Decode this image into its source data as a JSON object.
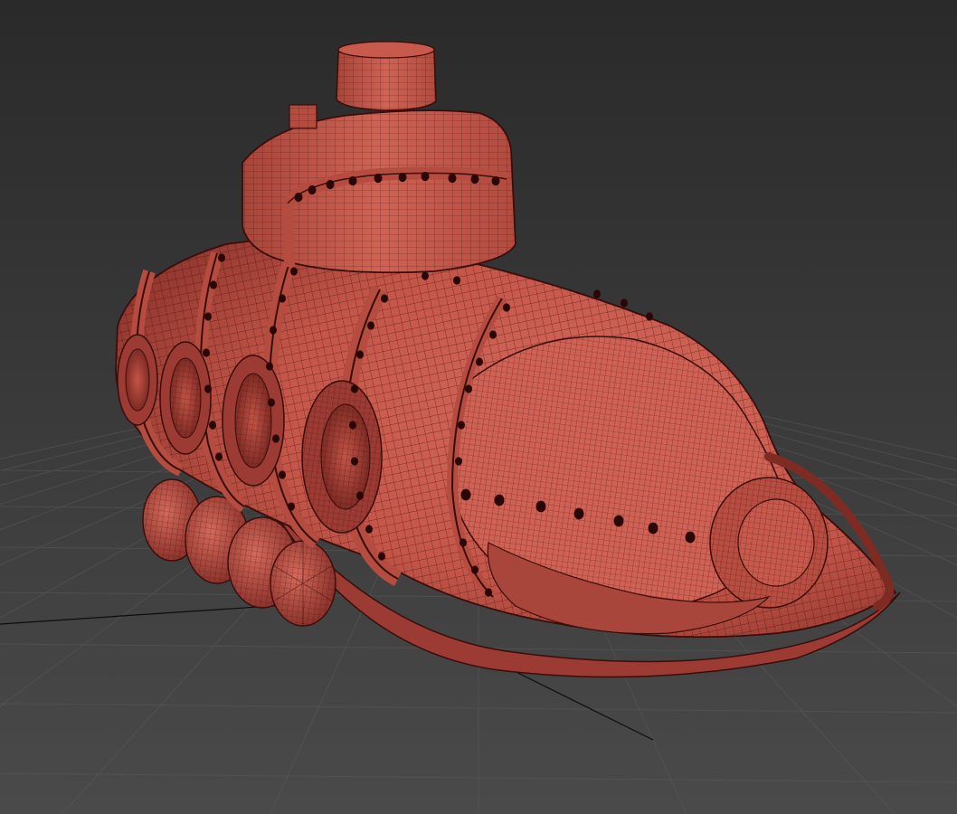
{
  "viewport": {
    "background_top": "#2e2e2e",
    "background_bottom": "#4a4a4a",
    "grid_color": "#5a5a5a",
    "axis_color": "#0d0d0d"
  },
  "model": {
    "name": "submarine",
    "base_color": "#c85a4e",
    "shade_color": "#8e342c",
    "highlight_color": "#df7a6c",
    "wire_color": "#3a0d0a",
    "rivet_color": "#2a0706"
  }
}
